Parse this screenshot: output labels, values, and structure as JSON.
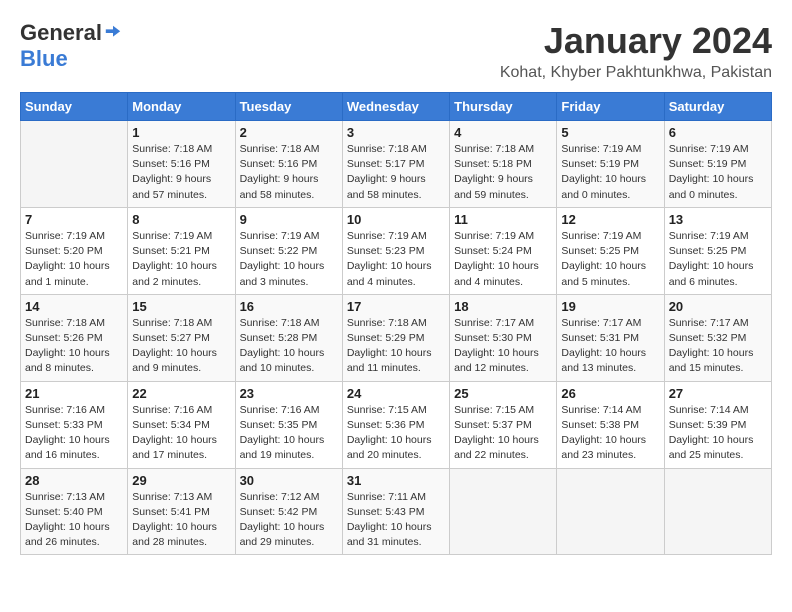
{
  "logo": {
    "general": "General",
    "blue": "Blue"
  },
  "title": "January 2024",
  "subtitle": "Kohat, Khyber Pakhtunkhwa, Pakistan",
  "days_of_week": [
    "Sunday",
    "Monday",
    "Tuesday",
    "Wednesday",
    "Thursday",
    "Friday",
    "Saturday"
  ],
  "weeks": [
    [
      {
        "day": "",
        "info": ""
      },
      {
        "day": "1",
        "info": "Sunrise: 7:18 AM\nSunset: 5:16 PM\nDaylight: 9 hours\nand 57 minutes."
      },
      {
        "day": "2",
        "info": "Sunrise: 7:18 AM\nSunset: 5:16 PM\nDaylight: 9 hours\nand 58 minutes."
      },
      {
        "day": "3",
        "info": "Sunrise: 7:18 AM\nSunset: 5:17 PM\nDaylight: 9 hours\nand 58 minutes."
      },
      {
        "day": "4",
        "info": "Sunrise: 7:18 AM\nSunset: 5:18 PM\nDaylight: 9 hours\nand 59 minutes."
      },
      {
        "day": "5",
        "info": "Sunrise: 7:19 AM\nSunset: 5:19 PM\nDaylight: 10 hours\nand 0 minutes."
      },
      {
        "day": "6",
        "info": "Sunrise: 7:19 AM\nSunset: 5:19 PM\nDaylight: 10 hours\nand 0 minutes."
      }
    ],
    [
      {
        "day": "7",
        "info": "Sunrise: 7:19 AM\nSunset: 5:20 PM\nDaylight: 10 hours\nand 1 minute."
      },
      {
        "day": "8",
        "info": "Sunrise: 7:19 AM\nSunset: 5:21 PM\nDaylight: 10 hours\nand 2 minutes."
      },
      {
        "day": "9",
        "info": "Sunrise: 7:19 AM\nSunset: 5:22 PM\nDaylight: 10 hours\nand 3 minutes."
      },
      {
        "day": "10",
        "info": "Sunrise: 7:19 AM\nSunset: 5:23 PM\nDaylight: 10 hours\nand 4 minutes."
      },
      {
        "day": "11",
        "info": "Sunrise: 7:19 AM\nSunset: 5:24 PM\nDaylight: 10 hours\nand 4 minutes."
      },
      {
        "day": "12",
        "info": "Sunrise: 7:19 AM\nSunset: 5:25 PM\nDaylight: 10 hours\nand 5 minutes."
      },
      {
        "day": "13",
        "info": "Sunrise: 7:19 AM\nSunset: 5:25 PM\nDaylight: 10 hours\nand 6 minutes."
      }
    ],
    [
      {
        "day": "14",
        "info": "Sunrise: 7:18 AM\nSunset: 5:26 PM\nDaylight: 10 hours\nand 8 minutes."
      },
      {
        "day": "15",
        "info": "Sunrise: 7:18 AM\nSunset: 5:27 PM\nDaylight: 10 hours\nand 9 minutes."
      },
      {
        "day": "16",
        "info": "Sunrise: 7:18 AM\nSunset: 5:28 PM\nDaylight: 10 hours\nand 10 minutes."
      },
      {
        "day": "17",
        "info": "Sunrise: 7:18 AM\nSunset: 5:29 PM\nDaylight: 10 hours\nand 11 minutes."
      },
      {
        "day": "18",
        "info": "Sunrise: 7:17 AM\nSunset: 5:30 PM\nDaylight: 10 hours\nand 12 minutes."
      },
      {
        "day": "19",
        "info": "Sunrise: 7:17 AM\nSunset: 5:31 PM\nDaylight: 10 hours\nand 13 minutes."
      },
      {
        "day": "20",
        "info": "Sunrise: 7:17 AM\nSunset: 5:32 PM\nDaylight: 10 hours\nand 15 minutes."
      }
    ],
    [
      {
        "day": "21",
        "info": "Sunrise: 7:16 AM\nSunset: 5:33 PM\nDaylight: 10 hours\nand 16 minutes."
      },
      {
        "day": "22",
        "info": "Sunrise: 7:16 AM\nSunset: 5:34 PM\nDaylight: 10 hours\nand 17 minutes."
      },
      {
        "day": "23",
        "info": "Sunrise: 7:16 AM\nSunset: 5:35 PM\nDaylight: 10 hours\nand 19 minutes."
      },
      {
        "day": "24",
        "info": "Sunrise: 7:15 AM\nSunset: 5:36 PM\nDaylight: 10 hours\nand 20 minutes."
      },
      {
        "day": "25",
        "info": "Sunrise: 7:15 AM\nSunset: 5:37 PM\nDaylight: 10 hours\nand 22 minutes."
      },
      {
        "day": "26",
        "info": "Sunrise: 7:14 AM\nSunset: 5:38 PM\nDaylight: 10 hours\nand 23 minutes."
      },
      {
        "day": "27",
        "info": "Sunrise: 7:14 AM\nSunset: 5:39 PM\nDaylight: 10 hours\nand 25 minutes."
      }
    ],
    [
      {
        "day": "28",
        "info": "Sunrise: 7:13 AM\nSunset: 5:40 PM\nDaylight: 10 hours\nand 26 minutes."
      },
      {
        "day": "29",
        "info": "Sunrise: 7:13 AM\nSunset: 5:41 PM\nDaylight: 10 hours\nand 28 minutes."
      },
      {
        "day": "30",
        "info": "Sunrise: 7:12 AM\nSunset: 5:42 PM\nDaylight: 10 hours\nand 29 minutes."
      },
      {
        "day": "31",
        "info": "Sunrise: 7:11 AM\nSunset: 5:43 PM\nDaylight: 10 hours\nand 31 minutes."
      },
      {
        "day": "",
        "info": ""
      },
      {
        "day": "",
        "info": ""
      },
      {
        "day": "",
        "info": ""
      }
    ]
  ]
}
